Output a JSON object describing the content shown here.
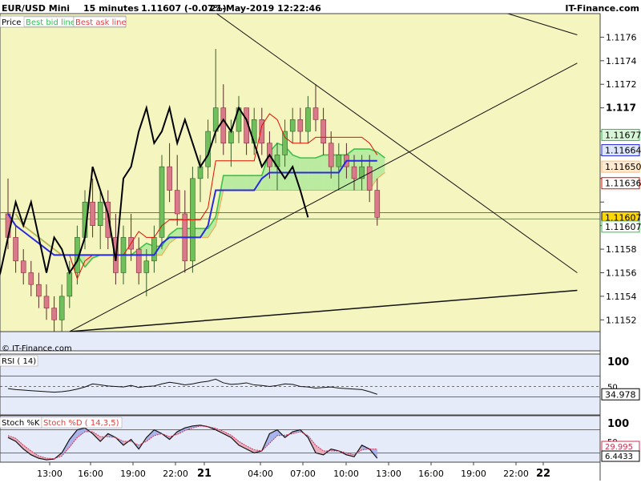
{
  "header": {
    "instrument": "EUR/USD Mini",
    "timeframe": "15 minutes",
    "quote": "1.11607 (-0.07%)",
    "datetime": "21-May-2019 12:22:46",
    "brand": "IT-Finance.com"
  },
  "legend": {
    "price": "Price",
    "best_bid": "Best bid line",
    "best_ask": "Best ask line"
  },
  "watermark": "© IT-Finance.com",
  "colors": {
    "chart_bg": "#f5f5c0",
    "sub_bg": "#e6ebfa",
    "cloud_green": "#b4ea9c",
    "cloud_orange": "#ffcf99",
    "tenkan": "#e01000",
    "kijun": "#2a2add",
    "chikou": "#000000",
    "bid": "#2fbf4f",
    "ask": "#e04040"
  },
  "chart_data": [
    {
      "type": "candlestick",
      "title": "",
      "ylim": [
        1.1151,
        1.1178
      ],
      "y_ticks": [
        1.1152,
        1.1154,
        1.1156,
        1.1158,
        1.116,
        1.1162,
        1.1164,
        1.1166,
        1.1168,
        1.117,
        1.1172,
        1.1174,
        1.1176
      ],
      "y_tick_labels": [
        "1.1152",
        "1.1154",
        "1.1156",
        "1.1158",
        "",
        "",
        "",
        "",
        "",
        "1.117",
        "1.1172",
        "1.1174",
        "1.1176"
      ],
      "bold_ticks": [
        "1.117"
      ],
      "x_labels": [
        "13:00",
        "16:00",
        "19:00",
        "22:00",
        "21",
        "04:00",
        "07:00",
        "10:00",
        "13:00",
        "16:00",
        "19:00",
        "22:00",
        "22"
      ],
      "price_tags": [
        {
          "label": "1.11677",
          "value": 1.11677,
          "color": "#d8f5d8",
          "border": "#2fbf4f"
        },
        {
          "label": "1.11664",
          "value": 1.11664,
          "color": "#dde6ff",
          "border": "#2a2add"
        },
        {
          "label": "1.11650",
          "value": 1.1165,
          "color": "#ffe9cf",
          "border": "#ffbf70"
        },
        {
          "label": "1.11636",
          "value": 1.11636,
          "color": "#ffffff",
          "border": "#e01000"
        },
        {
          "label": "1.11607",
          "value": 1.11607,
          "color": "#ffd700",
          "border": "#000000"
        },
        {
          "label": "1.11607",
          "value": 1.11606,
          "color": "#ffffff",
          "border": "#2fbf4f"
        }
      ],
      "bid": 1.11607,
      "ask": 1.11611,
      "candles": [
        [
          1.1161,
          1.1164,
          1.1158,
          1.1159
        ],
        [
          1.1159,
          1.116,
          1.1156,
          1.1157
        ],
        [
          1.1157,
          1.1158,
          1.1155,
          1.1156
        ],
        [
          1.1156,
          1.1157,
          1.1154,
          1.1155
        ],
        [
          1.1155,
          1.1156,
          1.1153,
          1.1154
        ],
        [
          1.1154,
          1.1155,
          1.1152,
          1.1153
        ],
        [
          1.1153,
          1.1154,
          1.1151,
          1.1152
        ],
        [
          1.1152,
          1.1155,
          1.1151,
          1.1154
        ],
        [
          1.1154,
          1.1157,
          1.1153,
          1.1156
        ],
        [
          1.1156,
          1.116,
          1.1155,
          1.1159
        ],
        [
          1.1159,
          1.1163,
          1.1158,
          1.1162
        ],
        [
          1.1162,
          1.1164,
          1.1159,
          1.116
        ],
        [
          1.116,
          1.1163,
          1.1158,
          1.1162
        ],
        [
          1.1162,
          1.1163,
          1.1158,
          1.1159
        ],
        [
          1.1159,
          1.1161,
          1.1155,
          1.1156
        ],
        [
          1.1156,
          1.116,
          1.1155,
          1.1159
        ],
        [
          1.1159,
          1.1161,
          1.1157,
          1.1158
        ],
        [
          1.1158,
          1.1159,
          1.1155,
          1.1156
        ],
        [
          1.1156,
          1.1158,
          1.1154,
          1.1157
        ],
        [
          1.1157,
          1.116,
          1.1156,
          1.1159
        ],
        [
          1.1159,
          1.1166,
          1.1158,
          1.1165
        ],
        [
          1.1165,
          1.1167,
          1.1162,
          1.1163
        ],
        [
          1.1163,
          1.1166,
          1.116,
          1.1161
        ],
        [
          1.1161,
          1.1163,
          1.1156,
          1.1157
        ],
        [
          1.1157,
          1.1165,
          1.1156,
          1.1164
        ],
        [
          1.1164,
          1.1166,
          1.1162,
          1.1165
        ],
        [
          1.1165,
          1.1169,
          1.1164,
          1.1168
        ],
        [
          1.1168,
          1.1175,
          1.1167,
          1.117
        ],
        [
          1.117,
          1.1172,
          1.1166,
          1.1167
        ],
        [
          1.1167,
          1.1169,
          1.1165,
          1.1168
        ],
        [
          1.1168,
          1.1171,
          1.1167,
          1.117
        ],
        [
          1.117,
          1.117,
          1.1166,
          1.1167
        ],
        [
          1.1167,
          1.117,
          1.1166,
          1.1169
        ],
        [
          1.1169,
          1.117,
          1.1166,
          1.1167
        ],
        [
          1.1167,
          1.1168,
          1.1164,
          1.1165
        ],
        [
          1.1165,
          1.1167,
          1.1163,
          1.1166
        ],
        [
          1.1166,
          1.1169,
          1.1165,
          1.1168
        ],
        [
          1.1168,
          1.117,
          1.1167,
          1.1169
        ],
        [
          1.1169,
          1.117,
          1.1167,
          1.1168
        ],
        [
          1.1168,
          1.1171,
          1.1167,
          1.117
        ],
        [
          1.117,
          1.1172,
          1.1168,
          1.1169
        ],
        [
          1.1169,
          1.117,
          1.1166,
          1.1167
        ],
        [
          1.1167,
          1.1168,
          1.1164,
          1.1165
        ],
        [
          1.1165,
          1.1167,
          1.1163,
          1.1166
        ],
        [
          1.1166,
          1.1167,
          1.1164,
          1.1165
        ],
        [
          1.1165,
          1.1166,
          1.1163,
          1.1164
        ],
        [
          1.1164,
          1.1166,
          1.1163,
          1.1165
        ],
        [
          1.1165,
          1.1166,
          1.1162,
          1.1163
        ],
        [
          1.1163,
          1.1164,
          1.116,
          1.11607
        ]
      ]
    },
    {
      "type": "line",
      "title": "RSI ( 14)",
      "ylim": [
        0,
        100
      ],
      "y_ticks": [
        100,
        50
      ],
      "last_value": "34.978",
      "values": [
        46,
        44,
        43,
        42,
        41,
        40,
        39,
        40,
        42,
        45,
        49,
        55,
        53,
        51,
        50,
        49,
        52,
        48,
        50,
        51,
        55,
        58,
        56,
        53,
        55,
        58,
        60,
        64,
        57,
        54,
        55,
        57,
        53,
        52,
        50,
        52,
        55,
        54,
        50,
        49,
        47,
        48,
        49,
        47,
        46,
        45,
        44,
        40,
        35
      ]
    },
    {
      "type": "line",
      "title": "Stoch %K",
      "subtitle": "Stoch %D ( 14,3,5)",
      "ylim": [
        0,
        100
      ],
      "y_ticks": [
        100,
        50
      ],
      "last_k": "6.4433",
      "last_d": "29.995",
      "series": [
        {
          "name": "Stoch %K",
          "values": [
            60,
            50,
            30,
            15,
            6,
            2,
            4,
            20,
            55,
            80,
            85,
            70,
            50,
            70,
            60,
            40,
            55,
            30,
            60,
            80,
            70,
            55,
            75,
            85,
            90,
            92,
            88,
            80,
            70,
            60,
            40,
            30,
            20,
            25,
            70,
            80,
            60,
            75,
            80,
            60,
            20,
            15,
            30,
            25,
            15,
            10,
            40,
            30,
            6
          ]
        },
        {
          "name": "Stoch %D",
          "values": [
            65,
            58,
            40,
            25,
            12,
            6,
            5,
            12,
            35,
            60,
            75,
            75,
            62,
            62,
            60,
            50,
            50,
            40,
            50,
            65,
            70,
            62,
            68,
            78,
            85,
            90,
            88,
            84,
            76,
            66,
            50,
            38,
            28,
            25,
            45,
            65,
            66,
            70,
            75,
            65,
            40,
            25,
            25,
            25,
            20,
            15,
            28,
            30,
            30
          ]
        }
      ]
    }
  ]
}
